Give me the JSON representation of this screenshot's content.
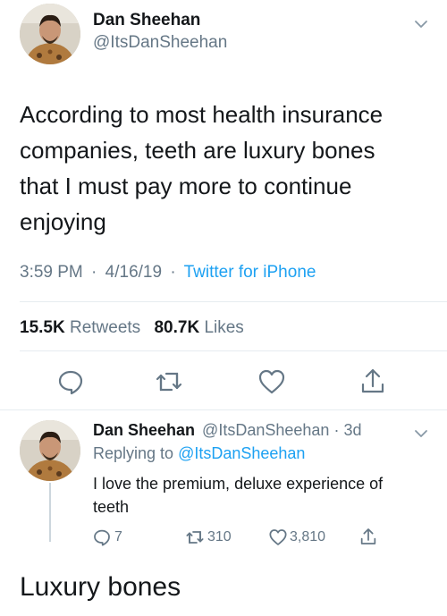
{
  "main_tweet": {
    "author_name": "Dan Sheehan",
    "author_handle": "@ItsDanSheehan",
    "text_lines": [
      "According to most health insurance",
      "companies, teeth are luxury bones",
      "that I must pay more to continue",
      "enjoying"
    ],
    "time": "3:59 PM",
    "date": "4/16/19",
    "separator": "·",
    "source": "Twitter for iPhone",
    "retweets_count": "15.5K",
    "retweets_label": "Retweets",
    "likes_count": "80.7K",
    "likes_label": "Likes",
    "actions": [
      "reply-icon",
      "retweet-icon",
      "like-icon",
      "share-icon"
    ]
  },
  "reply_tweet": {
    "author_name": "Dan Sheehan",
    "author_handle": "@ItsDanSheehan",
    "age": "3d",
    "separator": "·",
    "replying_prefix": "Replying to",
    "replying_handle": "@ItsDanSheehan",
    "text_lines": [
      "I love the premium, deluxe experience of",
      "teeth"
    ],
    "reply_count": "7",
    "retweet_count": "310",
    "like_count": "3,810"
  },
  "caption": "Luxury bones",
  "colors": {
    "text": "#14171a",
    "muted": "#657786",
    "accent": "#1da1f2",
    "divider": "#e6ecf0"
  }
}
